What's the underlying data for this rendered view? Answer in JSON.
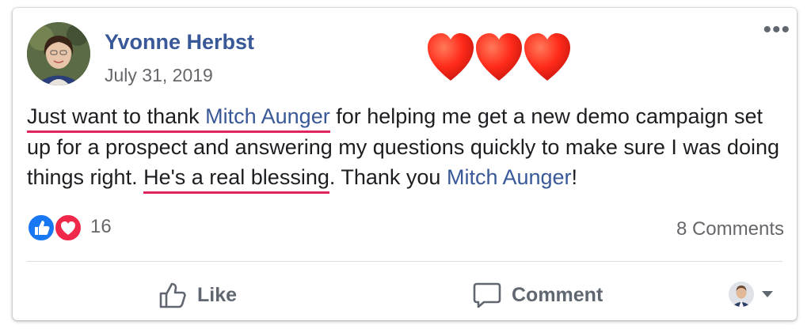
{
  "post": {
    "author": "Yvonne Herbst",
    "date": "July 31, 2019",
    "more_icon": "ellipsis-icon",
    "hearts_icon": "three-red-hearts",
    "text": {
      "part1_underlined": "Just want to thank ",
      "mention1": "Mitch Aunger",
      "part2": " for helping me get a new demo campaign set up for a prospect and answering my questions quickly to make sure I was doing things right. ",
      "part3_underlined": "He's a real blessing",
      "part4": ". Thank you ",
      "mention2": "Mitch Aunger",
      "part5": "!"
    },
    "reactions": {
      "icons": [
        "like-icon",
        "love-icon"
      ],
      "count": "16"
    },
    "comments_count": "8 Comments",
    "actions": {
      "like_label": "Like",
      "comment_label": "Comment"
    },
    "colors": {
      "link": "#385898",
      "underline": "#e0245e",
      "like_blue": "#1877f2",
      "love_red": "#f0284a",
      "heart": "#ff2a1a"
    }
  }
}
